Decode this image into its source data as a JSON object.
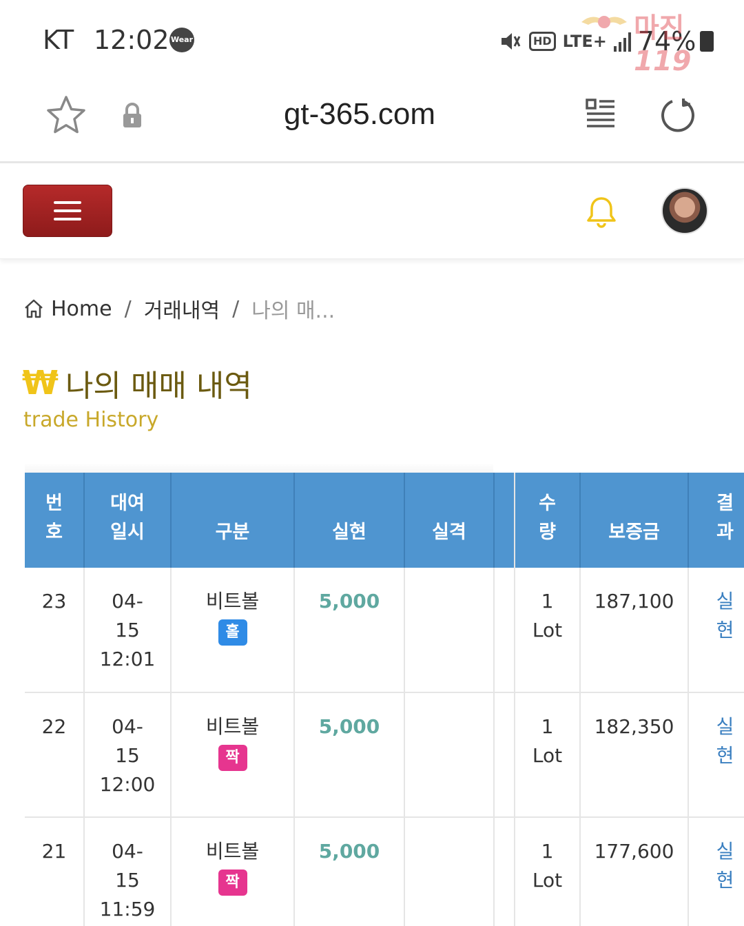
{
  "status_bar": {
    "carrier": "KT",
    "time": "12:02",
    "wear_badge": "Wear",
    "hd": "HD",
    "network": "LTE+",
    "battery": "74%",
    "watermark_text": "마진",
    "watermark_number": "119",
    "icons": [
      "mute-icon",
      "signal-icon",
      "battery-icon"
    ]
  },
  "browser": {
    "url": "gt-365.com",
    "icons": [
      "star-icon",
      "lock-icon",
      "reader-mode-icon",
      "reload-icon"
    ]
  },
  "header": {
    "icons": [
      "menu-icon",
      "bell-icon",
      "avatar"
    ],
    "accent_color": "#9e2222",
    "bell_color": "#f0c419"
  },
  "breadcrumb": {
    "home": "Home",
    "separator": "/",
    "middle": "거래내역",
    "current": "나의 매..."
  },
  "page": {
    "title_icon": "₩",
    "title": "나의 매매 내역",
    "subtitle": "trade History"
  },
  "table": {
    "header_color": "#4f95d0",
    "columns": [
      {
        "l1": "번",
        "l2": "호"
      },
      {
        "l1": "대여",
        "l2": "일시"
      },
      {
        "l1": "",
        "l2": "구분"
      },
      {
        "l1": "",
        "l2": "실현"
      },
      {
        "l1": "",
        "l2": "실격"
      },
      {
        "l1": "",
        "l2": ""
      },
      {
        "l1": "수",
        "l2": "량"
      },
      {
        "l1": "",
        "l2": "보증금"
      },
      {
        "l1": "결",
        "l2": "과"
      }
    ],
    "rows": [
      {
        "no": "23",
        "date1": "04-",
        "date2": "15",
        "time": "12:01",
        "type": "비트볼",
        "badge": "홀",
        "realized": "5,000",
        "disq": "",
        "qty1": "1",
        "qty2": "Lot",
        "deposit": "187,100",
        "res1": "실",
        "res2": "현"
      },
      {
        "no": "22",
        "date1": "04-",
        "date2": "15",
        "time": "12:00",
        "type": "비트볼",
        "badge": "짝",
        "realized": "5,000",
        "disq": "",
        "qty1": "1",
        "qty2": "Lot",
        "deposit": "182,350",
        "res1": "실",
        "res2": "현"
      },
      {
        "no": "21",
        "date1": "04-",
        "date2": "15",
        "time": "11:59",
        "type": "비트볼",
        "badge": "짝",
        "realized": "5,000",
        "disq": "",
        "qty1": "1",
        "qty2": "Lot",
        "deposit": "177,600",
        "res1": "실",
        "res2": "현"
      }
    ]
  }
}
